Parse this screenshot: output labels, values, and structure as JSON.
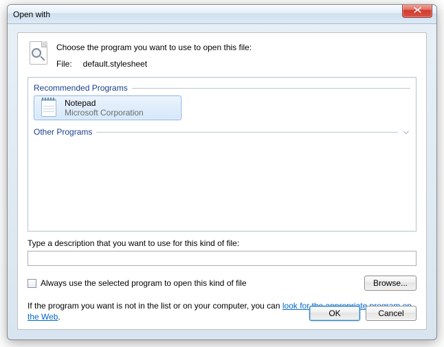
{
  "dialog": {
    "title": "Open with",
    "choose_text": "Choose the program you want to use to open this file:",
    "file_label": "File:",
    "file_name": "default.stylesheet"
  },
  "sections": {
    "recommended_label": "Recommended Programs",
    "other_label": "Other Programs"
  },
  "programs": [
    {
      "name": "Notepad",
      "publisher": "Microsoft Corporation",
      "selected": true
    }
  ],
  "description": {
    "label": "Type a description that you want to use for this kind of file:",
    "value": ""
  },
  "always_use": {
    "label": "Always use the selected program to open this kind of file",
    "checked": false
  },
  "browse_label": "Browse...",
  "hint": {
    "prefix": "If the program you want is not in the list or on your computer, you can ",
    "link": "look for the appropriate program on the Web",
    "suffix": "."
  },
  "buttons": {
    "ok": "OK",
    "cancel": "Cancel"
  }
}
